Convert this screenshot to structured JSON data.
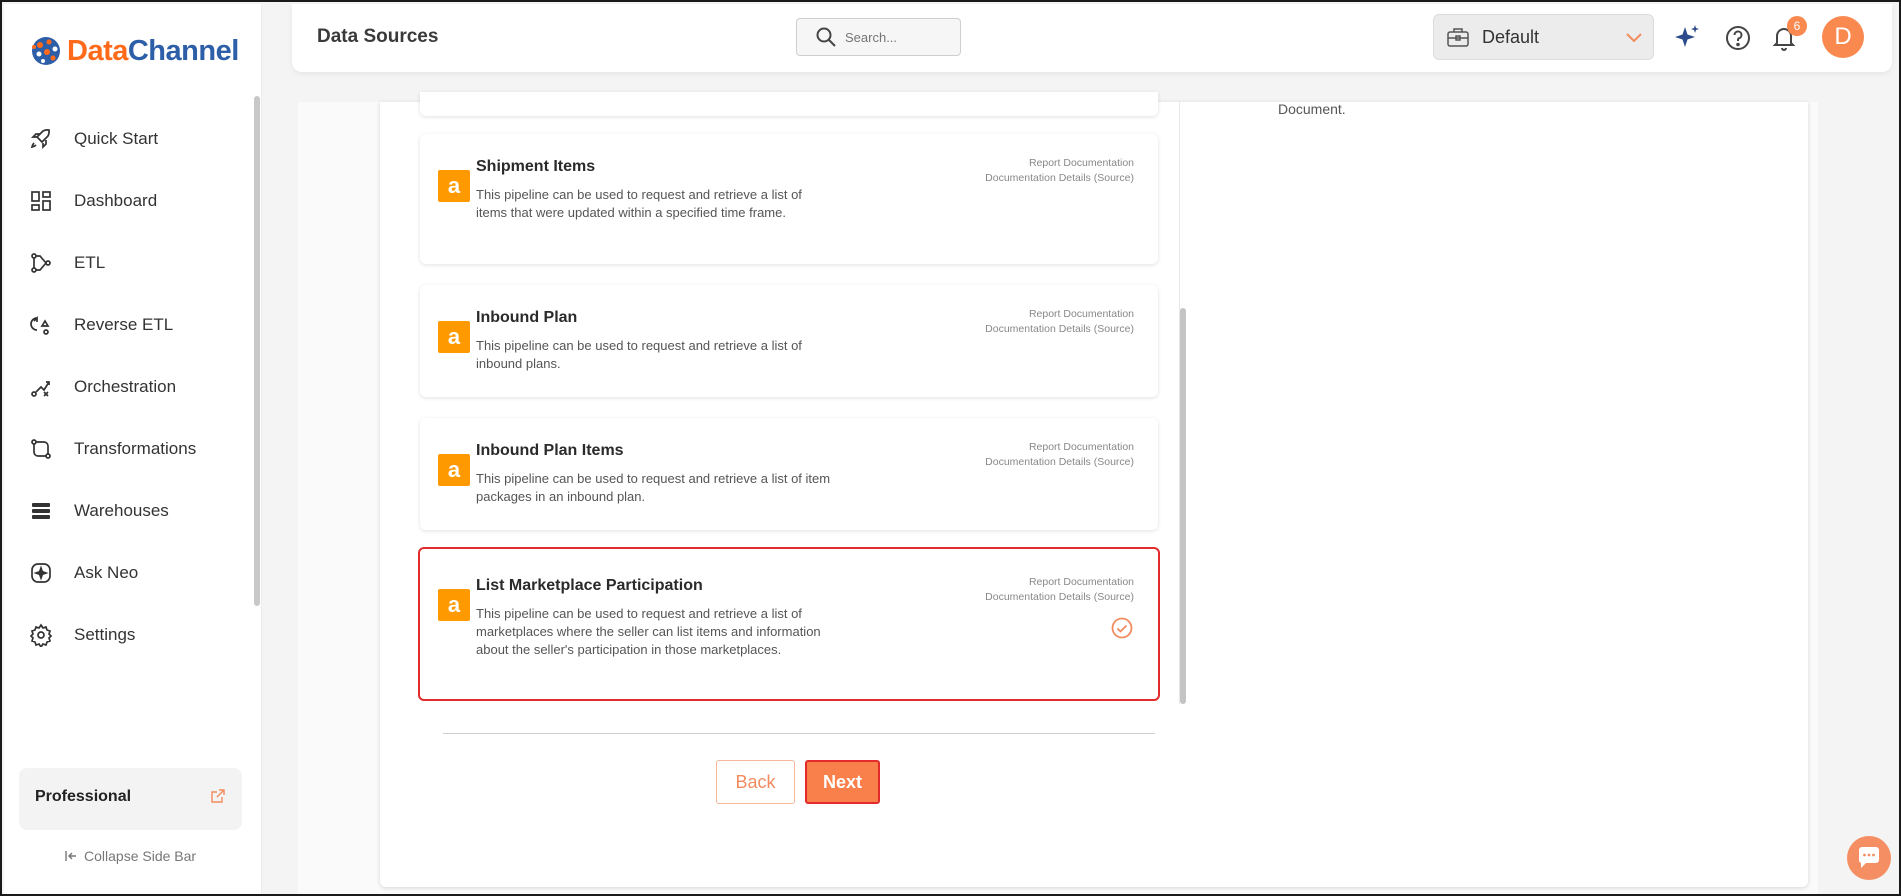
{
  "app": {
    "brand_part1": "Data",
    "brand_part2": "Channel",
    "brand_colors": {
      "orange": "#ff6a1a",
      "blue": "#2d5ea8"
    }
  },
  "sidebar": {
    "items": [
      {
        "label": "Quick Start",
        "icon": "rocket-icon"
      },
      {
        "label": "Dashboard",
        "icon": "dashboard-grid-icon"
      },
      {
        "label": "ETL",
        "icon": "etl-flow-icon"
      },
      {
        "label": "Reverse ETL",
        "icon": "reverse-etl-icon"
      },
      {
        "label": "Orchestration",
        "icon": "orchestration-icon"
      },
      {
        "label": "Transformations",
        "icon": "transformations-icon"
      },
      {
        "label": "Warehouses",
        "icon": "warehouse-stack-icon"
      },
      {
        "label": "Ask Neo",
        "icon": "sparkle-box-icon"
      },
      {
        "label": "Settings",
        "icon": "gear-icon"
      }
    ],
    "plan_label": "Professional",
    "collapse_label": "Collapse Side Bar"
  },
  "header": {
    "title": "Data Sources",
    "search_placeholder": "Search...",
    "workspace": "Default",
    "notification_count": "6",
    "avatar_initial": "D"
  },
  "main": {
    "right_text": "Document.",
    "cards": [
      {
        "title": "Shipment Items",
        "description": "This pipeline can be used to request and retrieve a list of items that were updated within a specified time frame.",
        "link1": "Report Documentation",
        "link2": "Documentation Details (Source)",
        "selected": false
      },
      {
        "title": "Inbound Plan",
        "description": "This pipeline can be used to request and retrieve a list of inbound plans.",
        "link1": "Report Documentation",
        "link2": "Documentation Details (Source)",
        "selected": false
      },
      {
        "title": "Inbound Plan Items",
        "description": "This pipeline can be used to request and retrieve a list of item packages in an inbound plan.",
        "link1": "Report Documentation",
        "link2": "Documentation Details (Source)",
        "selected": false
      },
      {
        "title": "List Marketplace Participation",
        "description": "This pipeline can be used to request and retrieve a list of marketplaces where the seller can list items and information about the seller's participation in those marketplaces.",
        "link1": "Report Documentation",
        "link2": "Documentation Details (Source)",
        "selected": true
      }
    ],
    "back_label": "Back",
    "next_label": "Next",
    "accent_color": "#f9804b"
  }
}
